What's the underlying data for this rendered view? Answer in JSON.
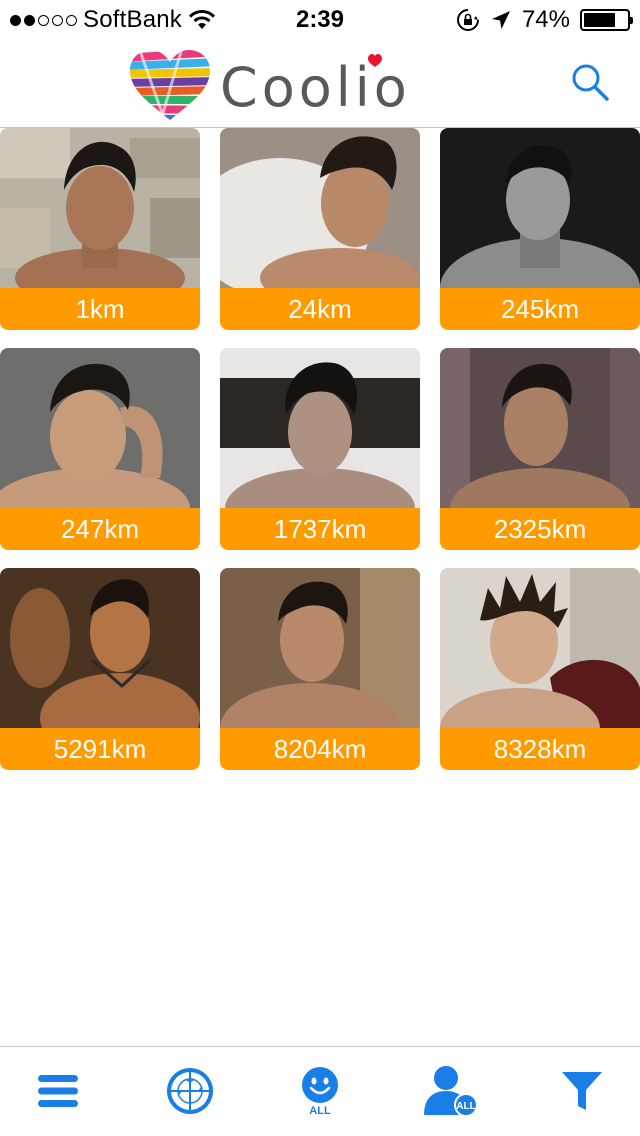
{
  "status_bar": {
    "signal_dots": [
      true,
      true,
      false,
      false,
      false
    ],
    "carrier": "SoftBank",
    "time": "2:39",
    "battery_percent": "74%",
    "battery_level": 0.74
  },
  "header": {
    "logo_text": "Coolio",
    "logo_icon": "rainbow-heart-icon",
    "search_icon": "search-icon"
  },
  "colors": {
    "accent_blue": "#1a7ee8",
    "distance_orange": "#ff9a00",
    "logo_text_gray": "#58595b"
  },
  "profiles": [
    {
      "distance": "1km"
    },
    {
      "distance": "24km"
    },
    {
      "distance": "245km"
    },
    {
      "distance": "247km"
    },
    {
      "distance": "1737km"
    },
    {
      "distance": "2325km"
    },
    {
      "distance": "5291km"
    },
    {
      "distance": "8204km"
    },
    {
      "distance": "8328km"
    }
  ],
  "tabbar": {
    "menu_icon": "hamburger-menu-icon",
    "radar_icon": "radar-crosshair-icon",
    "smiley_label": "ALL",
    "user_badge_label": "ALL",
    "filter_icon": "funnel-filter-icon"
  }
}
